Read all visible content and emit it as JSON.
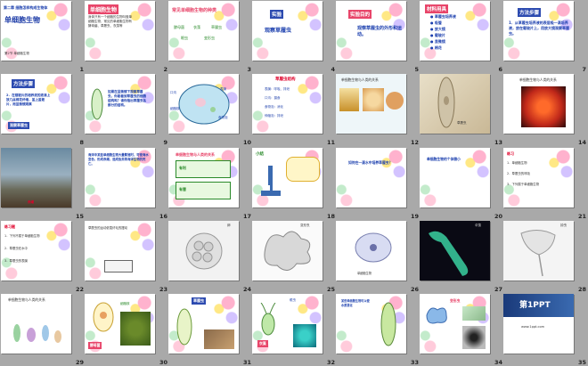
{
  "slides": [
    {
      "n": "1",
      "title": "单细胞生物",
      "top": "第二章 细胞怎样构成生物体",
      "foot": "第2节 单细胞生物"
    },
    {
      "n": "2",
      "title": "单细胞生物",
      "body": "身体只有一个细胞的生物叫做单细胞生物，常见的单细胞生物有酵母菌、草履虫、衣藻等"
    },
    {
      "n": "3",
      "title": "常见单细胞生物的种类",
      "a": "酵母菌",
      "b": "衣藻",
      "c": "草履虫",
      "d": "眼虫",
      "e": "变形虫"
    },
    {
      "n": "4",
      "box": "实验",
      "title": "观察草履虫"
    },
    {
      "n": "5",
      "box": "实验目的",
      "title": "观察草履虫的外形和运动。"
    },
    {
      "n": "6",
      "box": "材料用具",
      "items": [
        "● 草履虫培养液",
        "● 吸管",
        "● 放大镜",
        "● 载玻片",
        "● 显微镜",
        "● 棉花"
      ]
    },
    {
      "n": "7",
      "box": "方法步骤",
      "body": "1．从草履虫培养液的表层吸一滴培养液，放在载玻片上，用放大镜观察草履虫。"
    },
    {
      "n": "8",
      "box": "方法步骤",
      "body": "2．在载玻片的培养液的液滴上放几丝棉花纤维，盖上盖玻片，用显微镜观察",
      "tag": "观察草履虫"
    },
    {
      "n": "9",
      "body": "如果在显微镜下观察草履虫，你能看到草履虫的细胞结构吗？请你指出草履虫各部分的结构。"
    },
    {
      "n": "10",
      "title": "草履虫结构图",
      "l1": "口沟",
      "l2": "表膜",
      "l3": "细胞核",
      "l4": "食物泡"
    },
    {
      "n": "11",
      "title": "草履虫结构",
      "rows": [
        "表膜：呼吸、排泄",
        "口沟：摄食",
        "食物泡：消化",
        "伸缩泡：排泄"
      ]
    },
    {
      "n": "12",
      "title": "单细胞生物与人类的关系"
    },
    {
      "n": "13",
      "label": "草履虫"
    },
    {
      "n": "14",
      "title": "单细胞生物与人类的关系"
    },
    {
      "n": "15",
      "label": "赤潮"
    },
    {
      "n": "16",
      "body": "海洋中某些单细胞生物大量繁殖时，可使海水变色，形成赤潮，造成鱼类等海洋生物的死亡。"
    },
    {
      "n": "17",
      "a": "有利",
      "b": "有害",
      "c": "单细胞生物与人类的关系"
    },
    {
      "n": "18",
      "title": "小结"
    },
    {
      "n": "19",
      "body": "如何在一滴水中培养草履虫？"
    },
    {
      "n": "20",
      "title": "单细胞生物的个体微小"
    },
    {
      "n": "21",
      "title": "练习",
      "rows": [
        "1．单细胞生物",
        "2．草履虫的呼吸",
        "3．下列属于单细胞生物"
      ]
    },
    {
      "n": "22",
      "title": "练习题",
      "rows": [
        "1．下列不属于单细胞生物",
        "2．草履虫在水中",
        "3．草履虫的表膜"
      ]
    },
    {
      "n": "23",
      "body": "草履虫的运动依靠纤毛的摆动"
    },
    {
      "n": "24",
      "label": "卵"
    },
    {
      "n": "25",
      "label": "变形虫"
    },
    {
      "n": "26",
      "label": "单细胞生物"
    },
    {
      "n": "27",
      "label": "伞藻"
    },
    {
      "n": "28",
      "label": "钟虫"
    },
    {
      "n": "29",
      "title": "单细胞生物与人类的关系"
    },
    {
      "n": "30",
      "a": "酵母菌",
      "b": "细胞核"
    },
    {
      "n": "31",
      "a": "草履虫"
    },
    {
      "n": "32",
      "a": "衣藻",
      "b": "眼虫"
    },
    {
      "n": "33",
      "body": "某些单细胞生物可以使水质恶化"
    },
    {
      "n": "34",
      "a": "变形虫"
    },
    {
      "n": "35",
      "logo": "第1PPT",
      "sub": "www.1ppt.com"
    }
  ]
}
